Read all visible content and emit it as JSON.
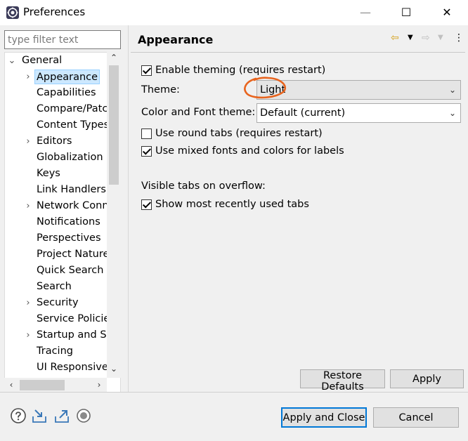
{
  "window": {
    "title": "Preferences",
    "minimize_icon": "—",
    "maximize_icon": "☐",
    "close_icon": "✕"
  },
  "filter": {
    "placeholder": "type filter text"
  },
  "tree": {
    "root": "General",
    "items": [
      {
        "label": "Appearance",
        "expandable": true,
        "selected": true
      },
      {
        "label": "Capabilities",
        "expandable": false
      },
      {
        "label": "Compare/Patch",
        "expandable": false
      },
      {
        "label": "Content Types",
        "expandable": false
      },
      {
        "label": "Editors",
        "expandable": true
      },
      {
        "label": "Globalization",
        "expandable": false
      },
      {
        "label": "Keys",
        "expandable": false
      },
      {
        "label": "Link Handlers",
        "expandable": false
      },
      {
        "label": "Network Connections",
        "expandable": true
      },
      {
        "label": "Notifications",
        "expandable": false
      },
      {
        "label": "Perspectives",
        "expandable": false
      },
      {
        "label": "Project Natures",
        "expandable": false
      },
      {
        "label": "Quick Search",
        "expandable": false
      },
      {
        "label": "Search",
        "expandable": false
      },
      {
        "label": "Security",
        "expandable": true
      },
      {
        "label": "Service Policies",
        "expandable": false
      },
      {
        "label": "Startup and Shutdown",
        "expandable": true
      },
      {
        "label": "Tracing",
        "expandable": false
      },
      {
        "label": "UI Responsiveness",
        "expandable": false
      }
    ]
  },
  "page": {
    "title": "Appearance",
    "back_icon": "⇦",
    "forward_icon": "⇨",
    "menu_icon": "⋮",
    "enable_theming": {
      "label": "Enable theming (requires restart)",
      "checked": true
    },
    "theme": {
      "label": "Theme:",
      "value": "Light"
    },
    "color_font_theme": {
      "label": "Color and Font theme:",
      "value": "Default (current)"
    },
    "round_tabs": {
      "label": "Use round tabs (requires restart)",
      "checked": false
    },
    "mixed_fonts": {
      "label": "Use mixed fonts and colors for labels",
      "checked": true
    },
    "visible_tabs_label": "Visible tabs on overflow:",
    "show_mru": {
      "label": "Show most recently used tabs",
      "checked": true
    },
    "restore_defaults": "Restore Defaults",
    "apply": "Apply"
  },
  "footer": {
    "apply_and_close": "Apply and Close",
    "cancel": "Cancel"
  },
  "colors": {
    "selection": "#cce8ff",
    "annotation": "#e8641e",
    "accent": "#0078d7"
  }
}
